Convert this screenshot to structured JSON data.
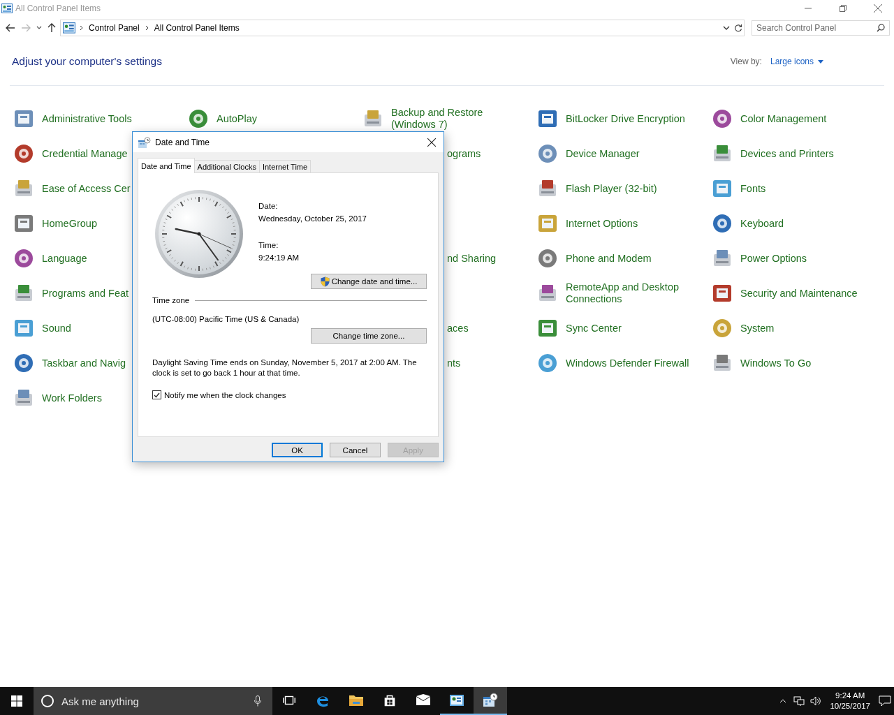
{
  "window": {
    "title": "All Control Panel Items"
  },
  "address_bar": {
    "crumbs": [
      "Control Panel",
      "All Control Panel Items"
    ]
  },
  "search": {
    "placeholder": "Search Control Panel"
  },
  "heading": "Adjust your computer's settings",
  "view_by": {
    "label": "View by:",
    "value": "Large icons"
  },
  "rows": [
    {
      "items": [
        {
          "kind": "item",
          "label": "Administrative Tools"
        },
        {
          "kind": "item",
          "label": "AutoPlay"
        },
        {
          "kind": "item",
          "label": "Backup and Restore (Windows 7)"
        },
        {
          "kind": "item",
          "label": "BitLocker Drive Encryption"
        },
        {
          "kind": "item",
          "label": "Color Management"
        }
      ]
    },
    {
      "items": [
        {
          "kind": "item",
          "label": "Credential Manage"
        },
        {
          "kind": "covered"
        },
        {
          "kind": "tail",
          "label": "ograms"
        },
        {
          "kind": "item",
          "label": "Device Manager"
        },
        {
          "kind": "item",
          "label": "Devices and Printers"
        }
      ]
    },
    {
      "items": [
        {
          "kind": "item",
          "label": "Ease of Access Cer"
        },
        {
          "kind": "covered"
        },
        {
          "kind": "covered"
        },
        {
          "kind": "item",
          "label": "Flash Player (32-bit)"
        },
        {
          "kind": "item",
          "label": "Fonts"
        }
      ]
    },
    {
      "items": [
        {
          "kind": "item",
          "label": "HomeGroup"
        },
        {
          "kind": "covered"
        },
        {
          "kind": "covered"
        },
        {
          "kind": "item",
          "label": "Internet Options"
        },
        {
          "kind": "item",
          "label": "Keyboard"
        }
      ]
    },
    {
      "items": [
        {
          "kind": "item",
          "label": "Language"
        },
        {
          "kind": "covered"
        },
        {
          "kind": "tail",
          "label": "nd Sharing"
        },
        {
          "kind": "item",
          "label": "Phone and Modem"
        },
        {
          "kind": "item",
          "label": "Power Options"
        }
      ]
    },
    {
      "items": [
        {
          "kind": "item",
          "label": "Programs and Feat"
        },
        {
          "kind": "covered"
        },
        {
          "kind": "covered"
        },
        {
          "kind": "item",
          "label": "RemoteApp and Desktop Connections"
        },
        {
          "kind": "item",
          "label": "Security and Maintenance"
        }
      ]
    },
    {
      "items": [
        {
          "kind": "item",
          "label": "Sound"
        },
        {
          "kind": "covered"
        },
        {
          "kind": "tail",
          "label": "aces"
        },
        {
          "kind": "item",
          "label": "Sync Center"
        },
        {
          "kind": "item",
          "label": "System"
        }
      ]
    },
    {
      "items": [
        {
          "kind": "item",
          "label": "Taskbar and Navig"
        },
        {
          "kind": "covered"
        },
        {
          "kind": "tail",
          "label": "nts"
        },
        {
          "kind": "item",
          "label": "Windows Defender Firewall"
        },
        {
          "kind": "item",
          "label": "Windows To Go"
        }
      ]
    },
    {
      "items": [
        {
          "kind": "item",
          "label": "Work Folders"
        }
      ]
    }
  ],
  "dialog": {
    "title": "Date and Time",
    "tabs": [
      {
        "label": "Date and Time",
        "selected": true
      },
      {
        "label": "Additional Clocks",
        "selected": false
      },
      {
        "label": "Internet Time",
        "selected": false
      }
    ],
    "date_label": "Date:",
    "date": "Wednesday, October 25, 2017",
    "time_label": "Time:",
    "time": "9:24:19 AM",
    "change_datetime_button": "Change date and time...",
    "timezone_heading": "Time zone",
    "timezone": "(UTC-08:00) Pacific Time (US & Canada)",
    "change_timezone_button": "Change time zone...",
    "dst_note": "Daylight Saving Time ends on Sunday, November 5, 2017 at 2:00 AM. The clock is set to go back 1 hour at that time.",
    "checkbox": {
      "label": "Notify me when the clock changes",
      "checked": true
    },
    "buttons": [
      {
        "label": "OK",
        "default": true,
        "disabled": false
      },
      {
        "label": "Cancel",
        "default": false,
        "disabled": false
      },
      {
        "label": "Apply",
        "default": false,
        "disabled": true
      }
    ]
  },
  "taskbar": {
    "search_placeholder": "Ask me anything",
    "apps": [
      {
        "kind": "taskview",
        "open": false,
        "selected": false
      },
      {
        "kind": "browser",
        "open": false,
        "selected": false
      },
      {
        "kind": "folder",
        "open": false,
        "selected": false
      },
      {
        "kind": "store",
        "open": false,
        "selected": false
      },
      {
        "kind": "mail",
        "open": false,
        "selected": false
      },
      {
        "kind": "panel",
        "open": true,
        "selected": false
      },
      {
        "kind": "calendar",
        "open": true,
        "selected": true
      }
    ],
    "time": "9:24 AM",
    "date": "10/25/2017"
  }
}
